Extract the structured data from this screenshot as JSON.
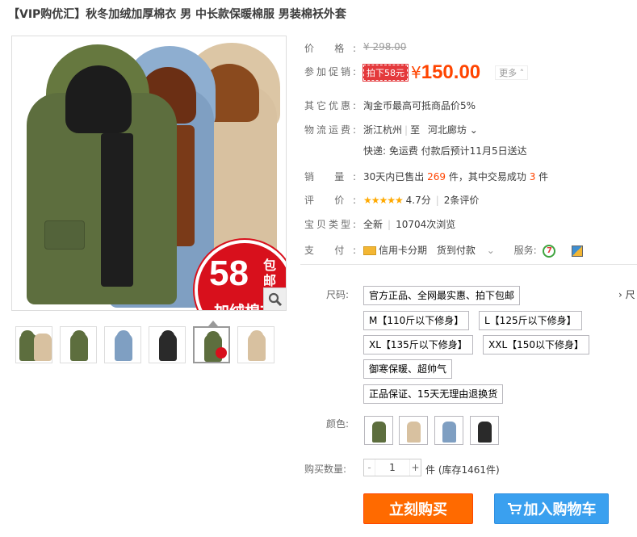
{
  "title": "【VIP购优汇】秋冬加绒加厚棉衣 男 中长款保暖棉服 男装棉袄外套",
  "badge": {
    "num": "58",
    "bao": "包邮",
    "text": "加绒棉衣"
  },
  "colors": {
    "accent": "#ff4400",
    "buy": "#ff6a00",
    "cart": "#3aa0ef",
    "olive": "#5d6e3e",
    "blue": "#7f9fc2",
    "khaki": "#d8c1a0",
    "black": "#2a2a2a"
  },
  "price": {
    "label": "价 格:",
    "original": "¥ 298.00"
  },
  "promo": {
    "label": "参加促销:",
    "tag": "拍下58元",
    "yen": "¥",
    "price": "150.00",
    "more": "更多 ˄"
  },
  "other": {
    "label": "其它优惠:",
    "text": "淘金币最高可抵商品价5%"
  },
  "shipping": {
    "label": "物流运费:",
    "from": "浙江杭州",
    "sep": "至",
    "to": "河北廊坊",
    "to_arrow": "⌄",
    "line2": "快递: 免运费 付款后预计11月5日送达"
  },
  "sales": {
    "label": "销 量:",
    "pre": "30天内已售出",
    "count": "269",
    "mid": "件，其中交易成功",
    "success": "3",
    "post": "件"
  },
  "rating": {
    "label": "评 价:",
    "stars": "★★★★★",
    "score": "4.7分",
    "reviews": "2条评价"
  },
  "type": {
    "label": "宝贝类型:",
    "condition": "全新",
    "views": "10704次浏览"
  },
  "pay": {
    "label": "支 付:",
    "credit": "信用卡分期",
    "cod": "货到付款",
    "service_label": "服务:"
  },
  "sku": {
    "size_label": "尺码:",
    "sizes": [
      "官方正品、全网最实惠、拍下包邮",
      "M【110斤以下修身】",
      "L【125斤以下修身】",
      "XL【135斤以下修身】",
      "XXL【150以下修身】",
      "御寒保暖、超帅气",
      "正品保证、15天无理由退换货"
    ],
    "size_more": "› 尺",
    "color_label": "颜色:",
    "color_swatches": [
      "olive",
      "khaki",
      "blue",
      "black"
    ]
  },
  "quantity": {
    "label": "购买数量:",
    "minus": "-",
    "value": "1",
    "plus": "+",
    "stock": "件 (库存1461件)"
  },
  "buttons": {
    "buy": "立刻购买",
    "cart": "加入购物车"
  }
}
